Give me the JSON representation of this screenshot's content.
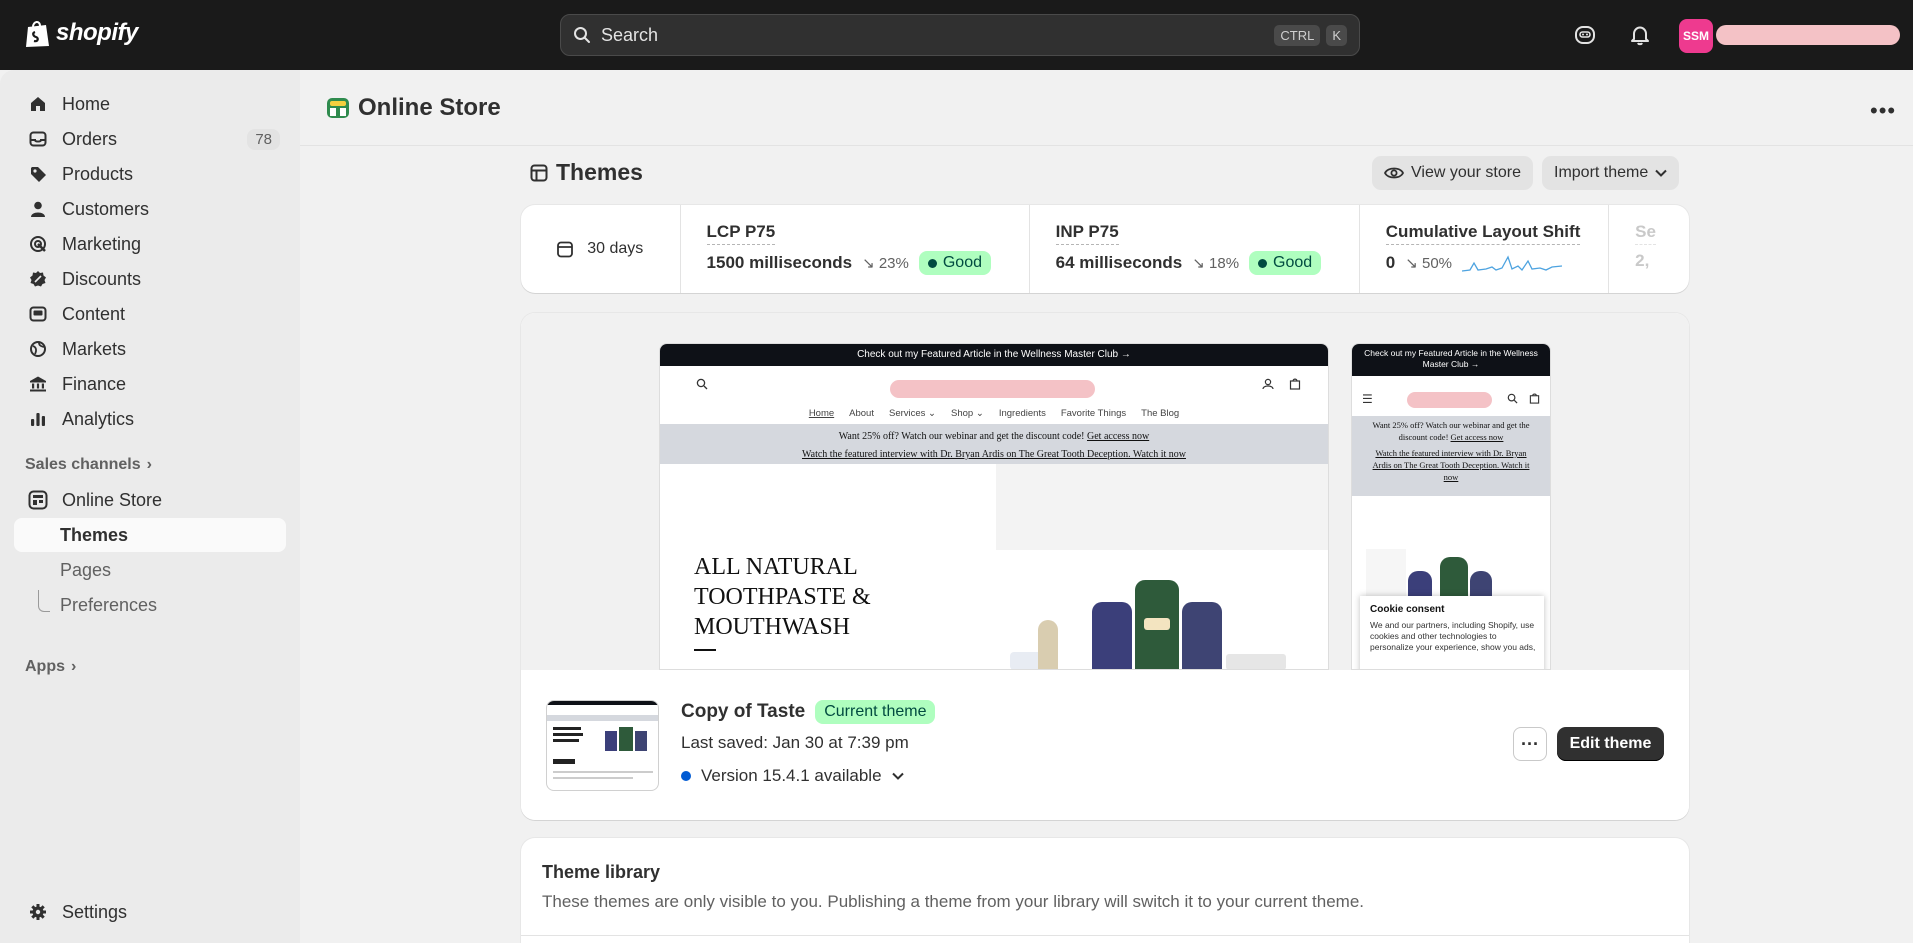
{
  "brand": {
    "logo_text": "shopify"
  },
  "search": {
    "placeholder": "Search",
    "shortcut_ctrl": "CTRL",
    "shortcut_key": "K"
  },
  "user": {
    "initials": "SSM",
    "avatar_color": "#ee3a8f"
  },
  "sidebar": {
    "items": [
      {
        "label": "Home",
        "icon": "home-icon"
      },
      {
        "label": "Orders",
        "icon": "orders-icon",
        "badge": "78"
      },
      {
        "label": "Products",
        "icon": "tag-icon"
      },
      {
        "label": "Customers",
        "icon": "person-icon"
      },
      {
        "label": "Marketing",
        "icon": "target-icon"
      },
      {
        "label": "Discounts",
        "icon": "discount-icon"
      },
      {
        "label": "Content",
        "icon": "content-icon"
      },
      {
        "label": "Markets",
        "icon": "globe-icon"
      },
      {
        "label": "Finance",
        "icon": "bank-icon"
      },
      {
        "label": "Analytics",
        "icon": "bar-chart-icon"
      }
    ],
    "sales_channels_label": "Sales channels",
    "online_store_label": "Online Store",
    "sub_items": [
      {
        "label": "Themes",
        "active": true
      },
      {
        "label": "Pages"
      },
      {
        "label": "Preferences"
      }
    ],
    "apps_label": "Apps",
    "settings_label": "Settings"
  },
  "page": {
    "title": "Online Store"
  },
  "themes": {
    "title": "Themes",
    "view_store_label": "View your store",
    "import_label": "Import theme"
  },
  "metrics": {
    "period": "30 days",
    "items": [
      {
        "label": "LCP P75",
        "value": "1500 milliseconds",
        "change": "23%",
        "status": "Good"
      },
      {
        "label": "INP P75",
        "value": "64 milliseconds",
        "change": "18%",
        "status": "Good"
      },
      {
        "label": "Cumulative Layout Shift",
        "value": "0",
        "change": "50%"
      },
      {
        "label": "Se",
        "value": "2,"
      }
    ]
  },
  "preview": {
    "announcement": "Check out my Featured Article in the Wellness Master Club →",
    "nav_links": [
      "Home",
      "About",
      "Services",
      "Shop",
      "Ingredients",
      "Favorite Things",
      "The Blog"
    ],
    "promo_1": "Want 25% off? Watch our webinar and get the discount code!",
    "promo_1_link": "Get access now",
    "promo_2": "Watch the featured interview with Dr. Bryan Ardis on The Great Tooth Deception. Watch it now",
    "hero_heading_lines": [
      "ALL NATURAL",
      "TOOTHPASTE &",
      "MOUTHWASH"
    ],
    "mobile_promo_1": "Want 25% off? Watch our webinar and get the discount code!",
    "mobile_promo_1_link": "Get access now",
    "mobile_promo_2": "Watch the featured interview with Dr. Bryan Ardis on The Great Tooth Deception. Watch it now",
    "cookie_title": "Cookie consent",
    "cookie_text": "We and our partners, including Shopify, use cookies and other technologies to personalize your experience, show you ads,"
  },
  "current_theme": {
    "name": "Copy of Taste",
    "badge": "Current theme",
    "last_saved": "Last saved: Jan 30 at 7:39 pm",
    "version": "Version 15.4.1 available",
    "edit_label": "Edit theme"
  },
  "library": {
    "title": "Theme library",
    "description": "These themes are only visible to you. Publishing a theme from your library will switch it to your current theme."
  },
  "colors": {
    "topbar": "#1a1a1a",
    "good_badge_bg": "#affebf",
    "good_badge_text": "#014b40",
    "primary_button": "#303030",
    "version_dot": "#005bd3"
  }
}
